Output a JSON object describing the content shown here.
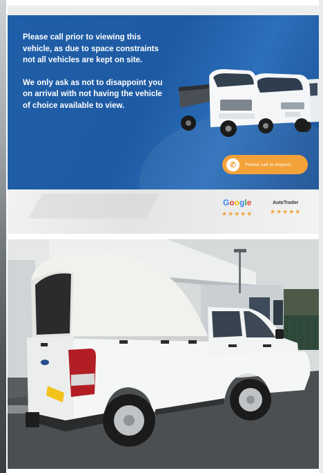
{
  "banner": {
    "paragraph_1": "Please call prior to viewing this vehicle, as due to space constraints not all vehicles are kept on site.",
    "paragraph_2": "We only ask as not to disappoint you on arrival with not having the vehicle of choice available to view.",
    "call_button_label": "Please call to enquire",
    "reviews": {
      "google_label": "Google",
      "google_stars": "★★★★★",
      "autotrader_label": "AutoTrader",
      "autotrader_stars": "★★★★★"
    }
  },
  "colors": {
    "banner_blue": "#1f5fa8",
    "accent_orange": "#f3a23a",
    "vehicle_white": "#f4f5f5"
  },
  "photo": {
    "subject": "white-pickup-with-canopy-icon"
  }
}
